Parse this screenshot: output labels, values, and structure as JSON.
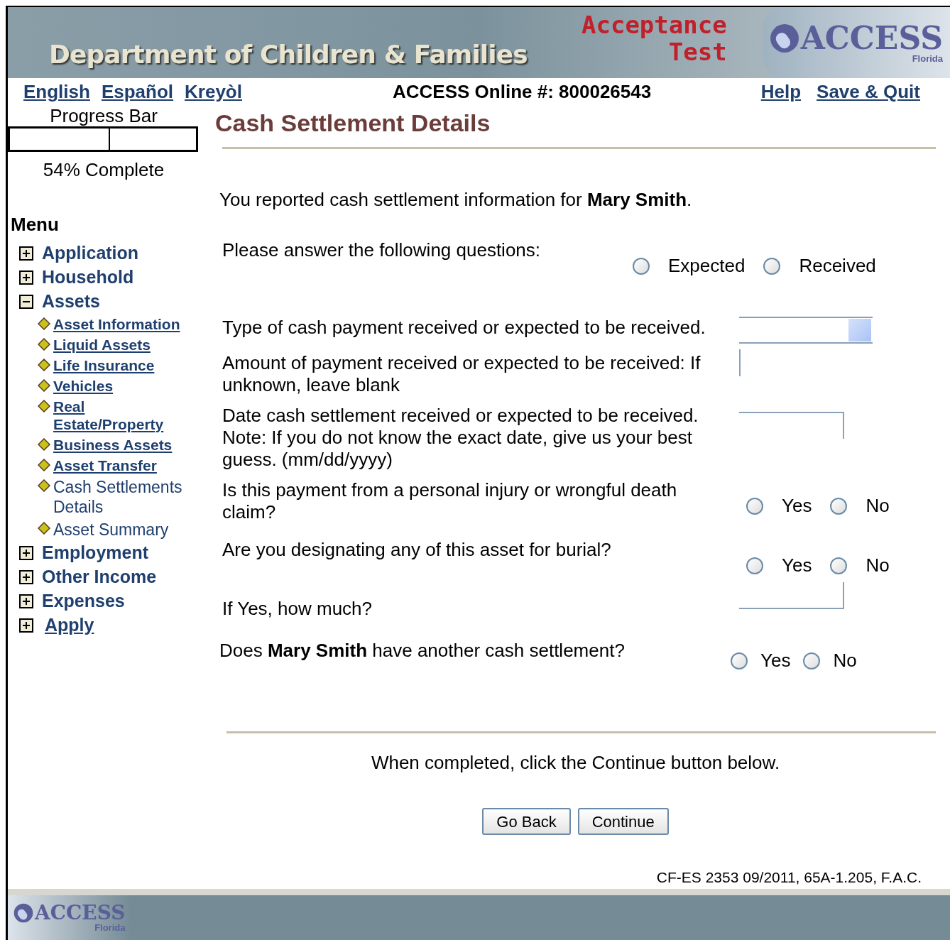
{
  "banner": {
    "title": "Department of Children & Families",
    "environment": [
      "Acceptance",
      "Test"
    ],
    "logo": {
      "name": "ACCESS",
      "state": "Florida"
    }
  },
  "languages": [
    {
      "label": "English"
    },
    {
      "label": "Español"
    },
    {
      "label": "Kreyòl"
    }
  ],
  "account": "ACCESS Online #: 800026543",
  "top_links": [
    {
      "label": "Help"
    },
    {
      "label": "Save & Quit"
    }
  ],
  "progress": {
    "label": "Progress Bar",
    "level": 0.54,
    "reading": "54% Complete"
  },
  "page_title": "Cash Settlement Details",
  "menu": {
    "title": "Menu",
    "sections": [
      {
        "label": "Application",
        "expanded": false,
        "link": false
      },
      {
        "label": "Household",
        "expanded": false,
        "link": false
      },
      {
        "label": "Assets",
        "expanded": true,
        "link": false,
        "children": [
          {
            "label": "Asset Information",
            "link": true
          },
          {
            "label": "Liquid Assets",
            "link": true
          },
          {
            "label": "Life Insurance",
            "link": true
          },
          {
            "label": "Vehicles",
            "link": true
          },
          {
            "label": "Real Estate/Property",
            "link": true
          },
          {
            "label": "Business Assets",
            "link": true
          },
          {
            "label": "Asset Transfer",
            "link": true
          },
          {
            "label": "Cash Settlements Details",
            "link": false
          },
          {
            "label": "Asset Summary",
            "link": false
          }
        ]
      },
      {
        "label": "Employment",
        "expanded": false,
        "link": false
      },
      {
        "label": "Other Income",
        "expanded": false,
        "link": false
      },
      {
        "label": "Expenses",
        "expanded": false,
        "link": false
      },
      {
        "label": "Apply",
        "expanded": false,
        "link": true
      }
    ]
  },
  "intro": "You reported cash settlement information for **Mary Smith**.",
  "questions": [
    {
      "kind": "radio",
      "text": "Please answer the following questions:",
      "options": [
        {
          "label": "Expected",
          "checked": false
        },
        {
          "label": "Received",
          "checked": false
        }
      ]
    },
    {
      "kind": "dropdown",
      "text": "Type of cash payment received or expected to be received."
    },
    {
      "kind": "amount",
      "text": "Amount of payment received or expected to be received: If unknown, leave blank"
    },
    {
      "kind": "date",
      "text": "Date cash settlement received or expected to be received. Note: If you do not know the exact date, give us your best guess. (mm/dd/yyyy)"
    },
    {
      "kind": "radio",
      "text": "Is this payment from a personal injury or wrongful death claim?",
      "options": [
        {
          "label": "Yes",
          "checked": false
        },
        {
          "label": "No",
          "checked": false
        }
      ]
    },
    {
      "kind": "radio",
      "text": "Are you designating any of this asset for burial?",
      "options": [
        {
          "label": "Yes",
          "checked": false
        },
        {
          "label": "No",
          "checked": false
        }
      ]
    },
    {
      "kind": "amount_small",
      "text": "If Yes, how much?"
    }
  ],
  "another": {
    "text": "Does **Mary Smith** have another cash settlement?",
    "options": [
      {
        "label": "Yes",
        "checked": false
      },
      {
        "label": "No",
        "checked": false
      }
    ]
  },
  "instruction": "When completed, click the Continue button below.",
  "buttons": [
    "Go Back",
    "Continue"
  ],
  "form_id": "CF-ES 2353 09/2011, 65A-1.205, F.A.C.",
  "footer_logo": {
    "name": "ACCESS",
    "state": "Florida"
  }
}
